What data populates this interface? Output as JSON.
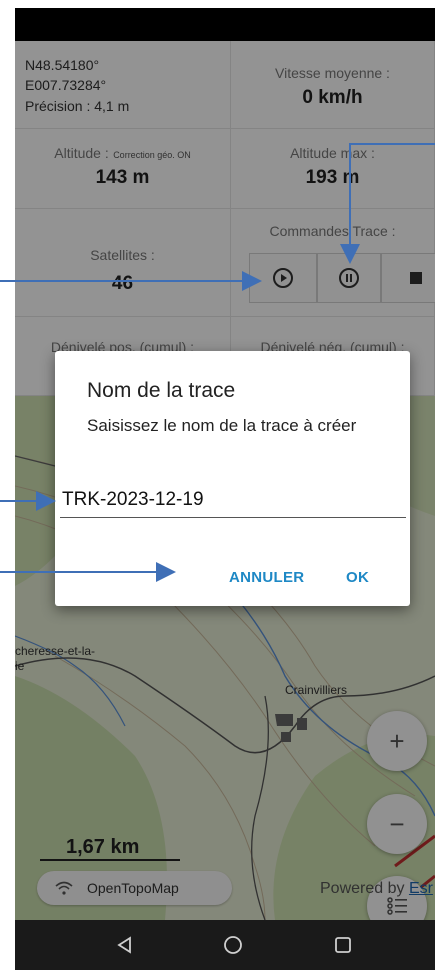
{
  "gps": {
    "lat": "N48.54180°",
    "lon": "E007.73284°",
    "precision": "Précision : 4,1 m"
  },
  "speed": {
    "label": "Vitesse moyenne :",
    "value": "0 km/h"
  },
  "altitude": {
    "label": "Altitude :",
    "correction": "Correction géo. ON",
    "value": "143 m"
  },
  "altitude_max": {
    "label": "Altitude max :",
    "value": "193 m"
  },
  "satellites": {
    "label": "Satellites :",
    "value": "46"
  },
  "trace_commands": {
    "label": "Commandes Trace :"
  },
  "elevation": {
    "pos_label": "Dénivelé pos. (cumul) :",
    "neg_label": "Dénivelé nég. (cumul) :"
  },
  "map": {
    "place_left": "cheresse-et-la-",
    "place_left2": "ie",
    "place_right": "Crainvilliers",
    "scale": "1,67 km",
    "provider": "OpenTopoMap",
    "attribution": "Powered by",
    "attribution_link": "Esr",
    "zoom_in": "+",
    "zoom_out": "−"
  },
  "dialog": {
    "title": "Nom de la trace",
    "message": "Saisissez le nom de la trace à créer",
    "input_value": "TRK-2023-12-19",
    "cancel": "ANNULER",
    "ok": "OK"
  },
  "colors": {
    "accent": "#1e88c5",
    "arrow": "#3f6fb6"
  }
}
